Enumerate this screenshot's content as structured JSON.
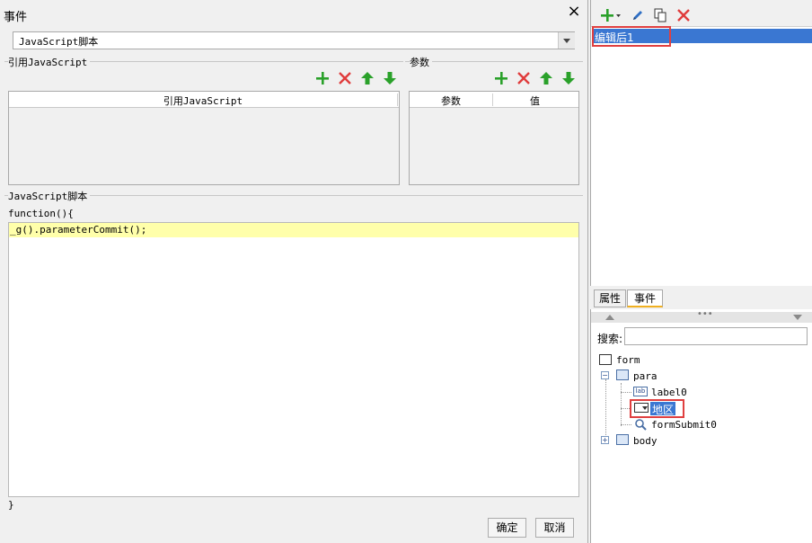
{
  "dialog": {
    "title": "事件",
    "script_type": "JavaScript脚本",
    "ref_section_label": "引用JavaScript",
    "ref_table_header": "引用JavaScript",
    "param_section_label": "参数",
    "param_header_name": "参数",
    "param_header_value": "值",
    "code_section_label": "JavaScript脚本",
    "code_signature": "function(){",
    "code_line": "_g().parameterCommit();",
    "code_end": "}",
    "ok_label": "确定",
    "cancel_label": "取消"
  },
  "events_panel": {
    "event_item": "编辑后1"
  },
  "tabs": [
    {
      "label": "属性"
    },
    {
      "label": "事件"
    }
  ],
  "widget_tree": {
    "search_label": "搜索:",
    "search_value": "",
    "nodes": [
      {
        "label": "form"
      },
      {
        "label": "para"
      },
      {
        "label": "label0"
      },
      {
        "label": "地区"
      },
      {
        "label": "formSubmit0"
      },
      {
        "label": "body"
      }
    ]
  },
  "colors": {
    "accent_green": "#2aa12a",
    "delete_red": "#e03c3c",
    "selection_blue": "#3a77d2",
    "code_highlight": "#ffffaa"
  }
}
